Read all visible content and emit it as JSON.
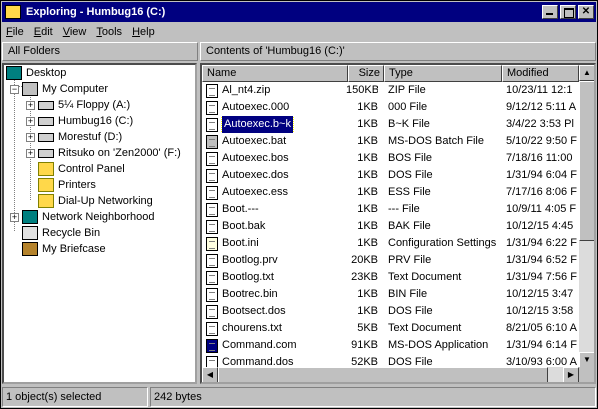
{
  "window": {
    "title": "Exploring - Humbug16 (C:)"
  },
  "menu": [
    "File",
    "Edit",
    "View",
    "Tools",
    "Help"
  ],
  "left_header": "All Folders",
  "right_header": "Contents of 'Humbug16 (C:)'",
  "tree": [
    {
      "label": "Desktop",
      "icon": "desktop-icon"
    },
    {
      "label": "My Computer",
      "icon": "computer-icon"
    },
    {
      "label": "5¼ Floppy (A:)",
      "icon": "floppy-icon"
    },
    {
      "label": "Humbug16 (C:)",
      "icon": "drive-icon"
    },
    {
      "label": "Morestuf (D:)",
      "icon": "drive-icon"
    },
    {
      "label": "Ritsuko on 'Zen2000' (F:)",
      "icon": "network-drive-icon"
    },
    {
      "label": "Control Panel",
      "icon": "folder-icon"
    },
    {
      "label": "Printers",
      "icon": "folder-icon"
    },
    {
      "label": "Dial-Up Networking",
      "icon": "folder-icon"
    },
    {
      "label": "Network Neighborhood",
      "icon": "network-icon"
    },
    {
      "label": "Recycle Bin",
      "icon": "recycle-bin-icon"
    },
    {
      "label": "My Briefcase",
      "icon": "briefcase-icon"
    }
  ],
  "columns": {
    "name": "Name",
    "size": "Size",
    "type": "Type",
    "modified": "Modified"
  },
  "files": [
    {
      "name": "Al_nt4.zip",
      "size": "150KB",
      "type": "ZIP File",
      "modified": "10/23/11 12:1"
    },
    {
      "name": "Autoexec.000",
      "size": "1KB",
      "type": "000 File",
      "modified": "9/12/12 5:11 A"
    },
    {
      "name": "Autoexec.b~k",
      "size": "1KB",
      "type": "B~K File",
      "modified": "3/4/22 3:53 Pl"
    },
    {
      "name": "Autoexec.bat",
      "size": "1KB",
      "type": "MS-DOS Batch File",
      "modified": "5/10/22 9:50 F"
    },
    {
      "name": "Autoexec.bos",
      "size": "1KB",
      "type": "BOS File",
      "modified": "7/18/16 11:00"
    },
    {
      "name": "Autoexec.dos",
      "size": "1KB",
      "type": "DOS File",
      "modified": "1/31/94 6:04 F"
    },
    {
      "name": "Autoexec.ess",
      "size": "1KB",
      "type": "ESS File",
      "modified": "7/17/16 8:06 F"
    },
    {
      "name": "Boot.---",
      "size": "1KB",
      "type": "--- File",
      "modified": "10/9/11 4:05 F"
    },
    {
      "name": "Boot.bak",
      "size": "1KB",
      "type": "BAK File",
      "modified": "10/12/15 4:45"
    },
    {
      "name": "Boot.ini",
      "size": "1KB",
      "type": "Configuration Settings",
      "modified": "1/31/94 6:22 F"
    },
    {
      "name": "Bootlog.prv",
      "size": "20KB",
      "type": "PRV File",
      "modified": "1/31/94 6:52 F"
    },
    {
      "name": "Bootlog.txt",
      "size": "23KB",
      "type": "Text Document",
      "modified": "1/31/94 7:56 F"
    },
    {
      "name": "Bootrec.bin",
      "size": "1KB",
      "type": "BIN File",
      "modified": "10/12/15 3:47"
    },
    {
      "name": "Bootsect.dos",
      "size": "1KB",
      "type": "DOS File",
      "modified": "10/12/15 3:58"
    },
    {
      "name": "chourens.txt",
      "size": "5KB",
      "type": "Text Document",
      "modified": "8/21/05 6:10 A"
    },
    {
      "name": "Command.com",
      "size": "91KB",
      "type": "MS-DOS Application",
      "modified": "1/31/94 6:14 F"
    },
    {
      "name": "Command.dos",
      "size": "52KB",
      "type": "DOS File",
      "modified": "3/10/93 6:00 A"
    }
  ],
  "status": {
    "selection": "1 object(s) selected",
    "size": "242 bytes"
  },
  "colors": {
    "title_bar": "#000080",
    "selection": "#000080",
    "face": "#c0c0c0"
  }
}
